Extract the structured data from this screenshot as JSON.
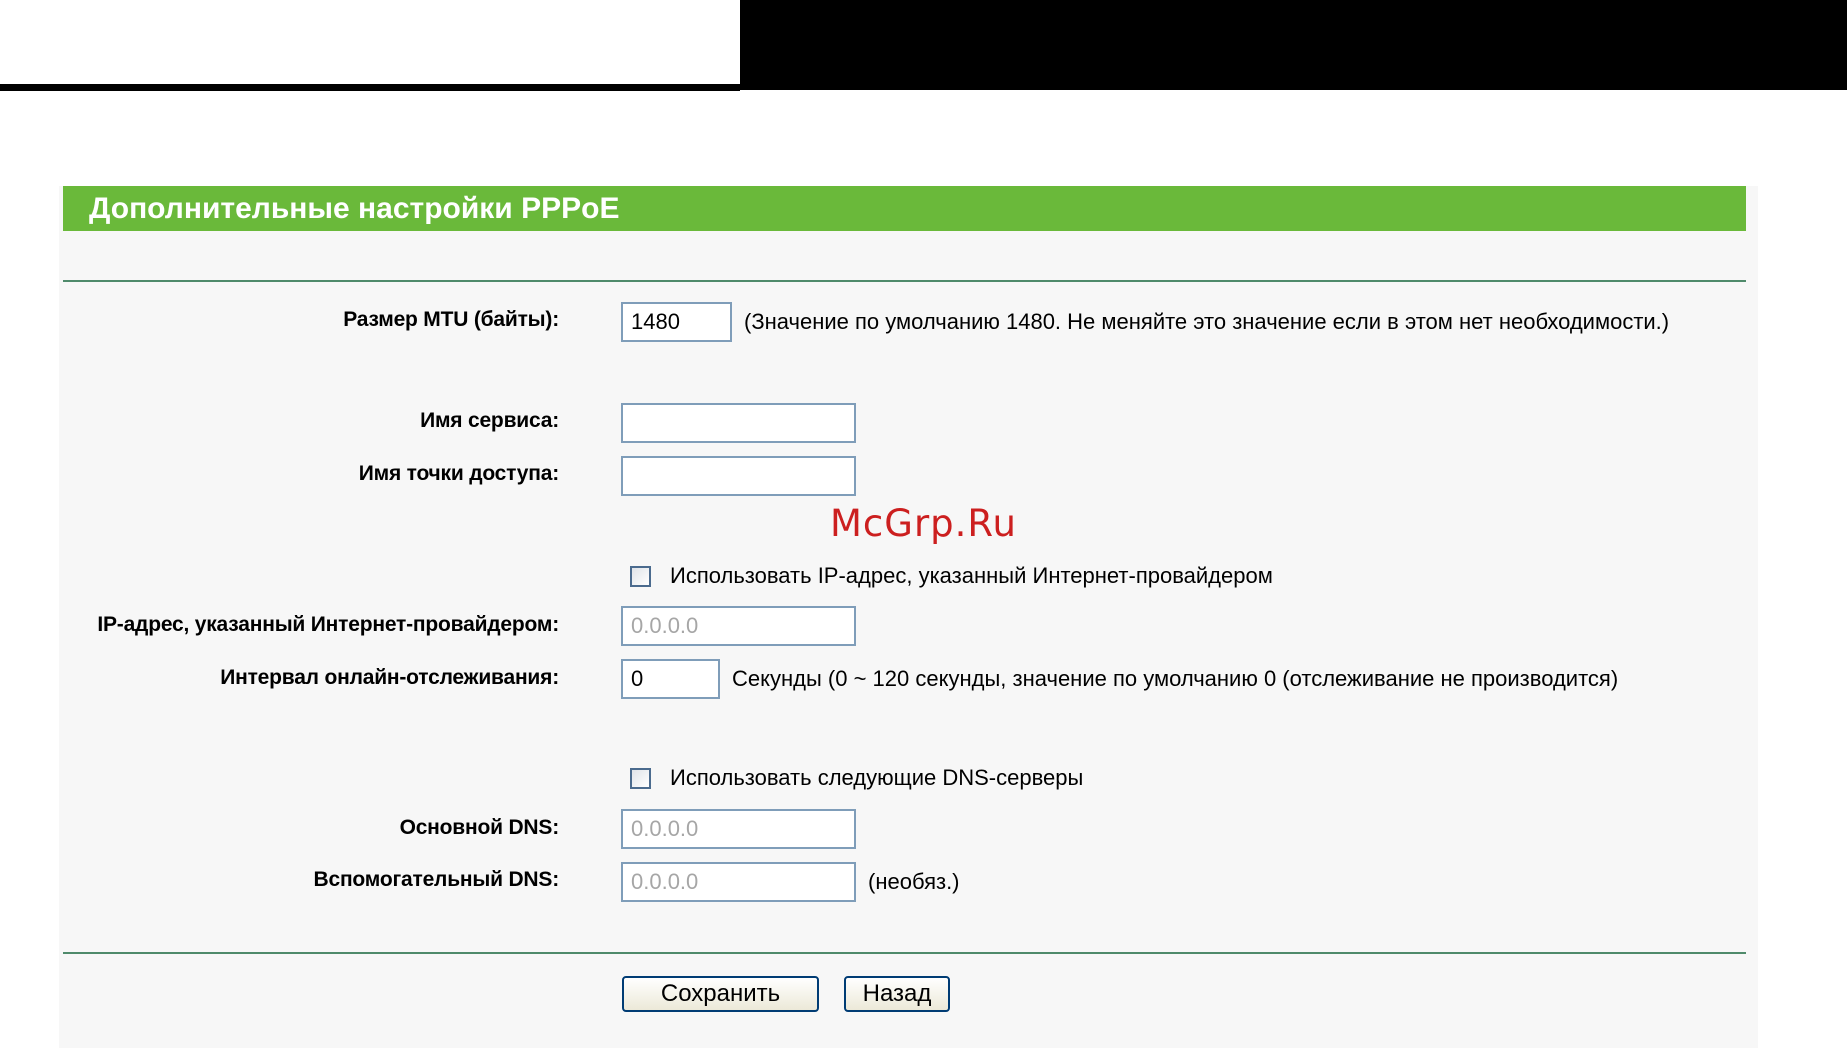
{
  "header": {
    "title": "Дополнительные настройки PPPoE"
  },
  "watermark": "McGrp.Ru",
  "form": {
    "mtu": {
      "label": "Размер MTU (байты):",
      "value": "1480",
      "hint": "(Значение по умолчанию 1480. Не меняйте это значение если в этом нет необходимости.)"
    },
    "service_name": {
      "label": "Имя сервиса:",
      "value": ""
    },
    "ac_name": {
      "label": "Имя точки доступа:",
      "value": ""
    },
    "use_isp_ip": {
      "label": "Использовать IP-адрес, указанный Интернет-провайдером",
      "checked": false
    },
    "isp_ip": {
      "label": "IP-адрес, указанный Интернет-провайдером:",
      "value": "0.0.0.0"
    },
    "echo_interval": {
      "label": "Интервал онлайн-отслеживания:",
      "value": "0",
      "hint": "Секунды (0 ~ 120 секунды, значение по умолчанию 0 (отслеживание не производится)"
    },
    "use_dns": {
      "label": "Использовать следующие DNS-серверы",
      "checked": false
    },
    "primary_dns": {
      "label": "Основной DNS:",
      "value": "0.0.0.0"
    },
    "secondary_dns": {
      "label": "Вспомогательный DNS:",
      "value": "0.0.0.0",
      "hint": "(необяз.)"
    }
  },
  "buttons": {
    "save": "Сохранить",
    "back": "Назад"
  },
  "colors": {
    "header_green": "#6ab93a",
    "divider": "#4f8a6b",
    "input_border": "#7f9db9",
    "watermark": "#cc1f1f"
  }
}
